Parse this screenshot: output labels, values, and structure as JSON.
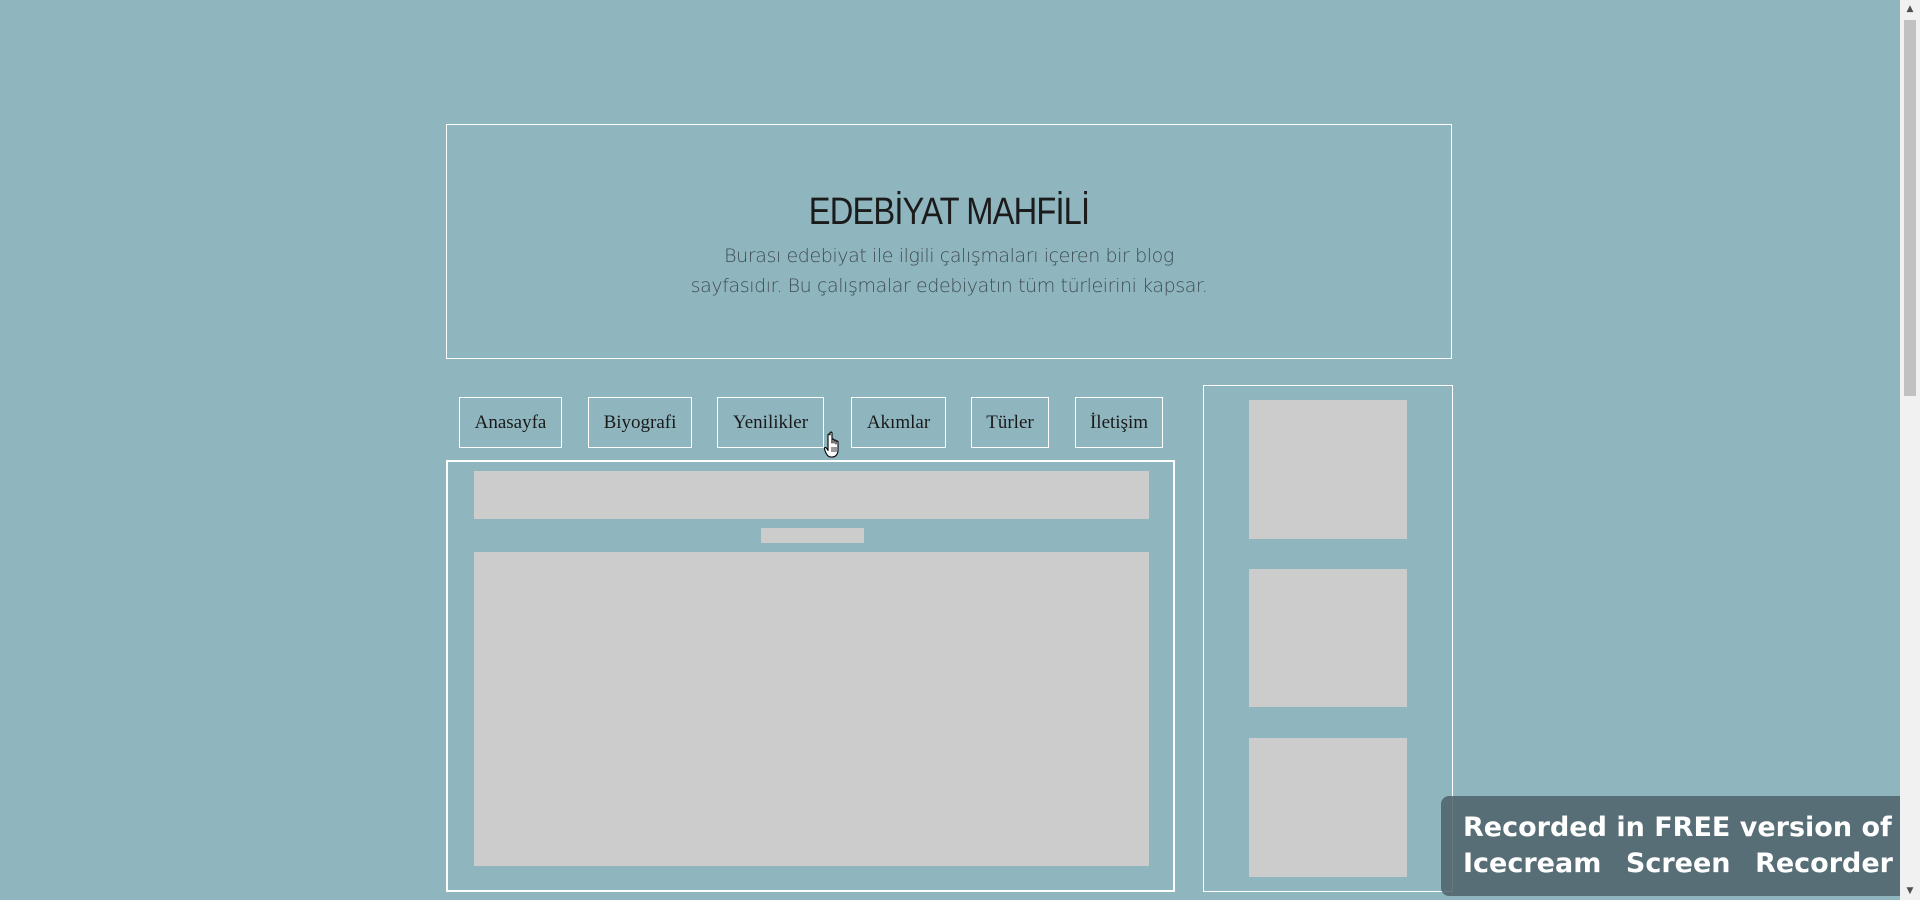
{
  "header": {
    "title": "EDEBİYAT MAHFİLİ",
    "description_line1": "Burası edebiyat ile ilgili çalışmaları içeren bir blog",
    "description_line2": "sayfasıdır. Bu çalışmalar edebiyatın tüm türleirini kapsar."
  },
  "nav": {
    "items": [
      {
        "label": "Anasayfa"
      },
      {
        "label": "Biyografi"
      },
      {
        "label": "Yenilikler"
      },
      {
        "label": "Akımlar"
      },
      {
        "label": "Türler"
      },
      {
        "label": "İletişim"
      }
    ]
  },
  "watermark": {
    "line1": "Recorded in FREE version of",
    "line2": "Icecream Screen Recorder"
  },
  "colors": {
    "background": "#8fb6bf",
    "border": "#ffffff",
    "placeholder": "#cccccc"
  },
  "icons": {
    "cursor": "hand-pointer-icon",
    "scroll_up": "triangle-up-icon",
    "scroll_down": "triangle-down-icon"
  }
}
